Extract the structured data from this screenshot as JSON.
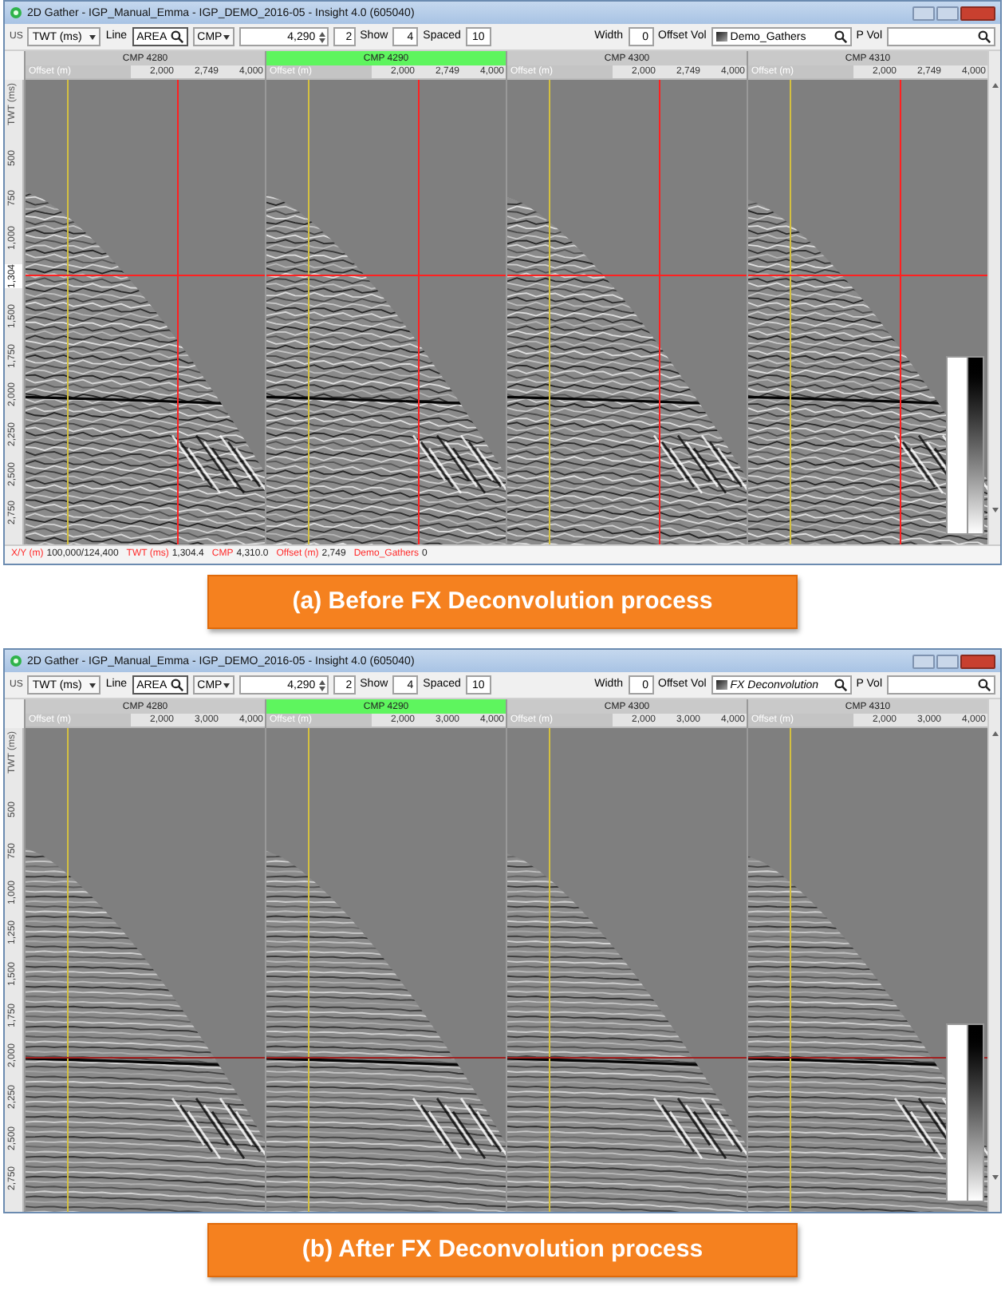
{
  "windows": [
    {
      "title": "2D Gather - IGP_Manual_Emma - IGP_DEMO_2016-05 - Insight 4.0 (605040)",
      "filtered": false,
      "toolbar": {
        "unit": "US",
        "domain": "TWT (ms)",
        "line_label": "Line",
        "line_value": "AREA",
        "key": "CMP",
        "cmp_value": "4,290",
        "step_value": "2",
        "show_label": "Show",
        "show_value": "4",
        "spaced_label": "Spaced",
        "spaced_value": "10",
        "width_label": "Width",
        "width_value": "0",
        "offset_vol_label": "Offset Vol",
        "offset_vol_value": "Demo_Gathers",
        "p_vol_label": "P Vol"
      },
      "panels": [
        {
          "title": "CMP 4280",
          "selected": false,
          "axis_label": "Offset (m)",
          "ticks": [
            "2,000",
            "2,749",
            "4,000"
          ]
        },
        {
          "title": "CMP 4290",
          "selected": true,
          "axis_label": "Offset (m)",
          "ticks": [
            "2,000",
            "2,749",
            "4,000"
          ]
        },
        {
          "title": "CMP 4300",
          "selected": false,
          "axis_label": "Offset (m)",
          "ticks": [
            "2,000",
            "2,749",
            "4,000"
          ]
        },
        {
          "title": "CMP 4310",
          "selected": false,
          "axis_label": "Offset (m)",
          "ticks": [
            "2,000",
            "2,749",
            "4,000"
          ]
        }
      ],
      "time_axis": {
        "label": "TWT (ms)",
        "ticks": [
          {
            "kind": "tick",
            "label": "500"
          },
          {
            "kind": "tick",
            "label": "750"
          },
          {
            "kind": "tick",
            "label": "1,000"
          },
          {
            "kind": "cursor",
            "label": "1,304"
          },
          {
            "kind": "tick",
            "label": "1,500"
          },
          {
            "kind": "tick",
            "label": "1,750"
          },
          {
            "kind": "tick",
            "label": "2,000"
          },
          {
            "kind": "tick",
            "label": "2,250"
          },
          {
            "kind": "tick",
            "label": "2,500"
          },
          {
            "kind": "tick",
            "label": "2,750"
          }
        ]
      },
      "cursor": {
        "kind": "cross"
      },
      "status_bar": [
        {
          "label": "X/Y (m)",
          "value": "100,000/124,400"
        },
        {
          "label": "TWT (ms)",
          "value": "1,304.4"
        },
        {
          "label": "CMP",
          "value": "4,310.0"
        },
        {
          "label": "Offset (m)",
          "value": "2,749"
        },
        {
          "label": "Demo_Gathers",
          "value": "0"
        }
      ],
      "caption": "(a) Before FX Deconvolution process"
    },
    {
      "title": "2D Gather - IGP_Manual_Emma - IGP_DEMO_2016-05 - Insight 4.0 (605040)",
      "filtered": true,
      "toolbar": {
        "unit": "US",
        "domain": "TWT (ms)",
        "line_label": "Line",
        "line_value": "AREA",
        "key": "CMP",
        "cmp_value": "4,290",
        "step_value": "2",
        "show_label": "Show",
        "show_value": "4",
        "spaced_label": "Spaced",
        "spaced_value": "10",
        "width_label": "Width",
        "width_value": "0",
        "offset_vol_label": "Offset Vol",
        "offset_vol_value": "FX Deconvolution",
        "p_vol_label": "P Vol"
      },
      "panels": [
        {
          "title": "CMP 4280",
          "selected": false,
          "axis_label": "Offset (m)",
          "ticks": [
            "2,000",
            "3,000",
            "4,000"
          ]
        },
        {
          "title": "CMP 4290",
          "selected": true,
          "axis_label": "Offset (m)",
          "ticks": [
            "2,000",
            "3,000",
            "4,000"
          ]
        },
        {
          "title": "CMP 4300",
          "selected": false,
          "axis_label": "Offset (m)",
          "ticks": [
            "2,000",
            "3,000",
            "4,000"
          ]
        },
        {
          "title": "CMP 4310",
          "selected": false,
          "axis_label": "Offset (m)",
          "ticks": [
            "2,000",
            "3,000",
            "4,000"
          ]
        }
      ],
      "time_axis": {
        "label": "TWT (ms)",
        "ticks": [
          {
            "kind": "tick",
            "label": "500"
          },
          {
            "kind": "tick",
            "label": "750"
          },
          {
            "kind": "tick",
            "label": "1,000"
          },
          {
            "kind": "tick",
            "label": "1,250"
          },
          {
            "kind": "tick",
            "label": "1,500"
          },
          {
            "kind": "tick",
            "label": "1,750"
          },
          {
            "kind": "tick",
            "label": "2,000"
          },
          {
            "kind": "tick",
            "label": "2,250"
          },
          {
            "kind": "tick",
            "label": "2,500"
          },
          {
            "kind": "tick",
            "label": "2,750"
          }
        ]
      },
      "cursor": {
        "kind": "horizontal"
      },
      "caption": "(b) After FX Deconvolution process"
    }
  ]
}
